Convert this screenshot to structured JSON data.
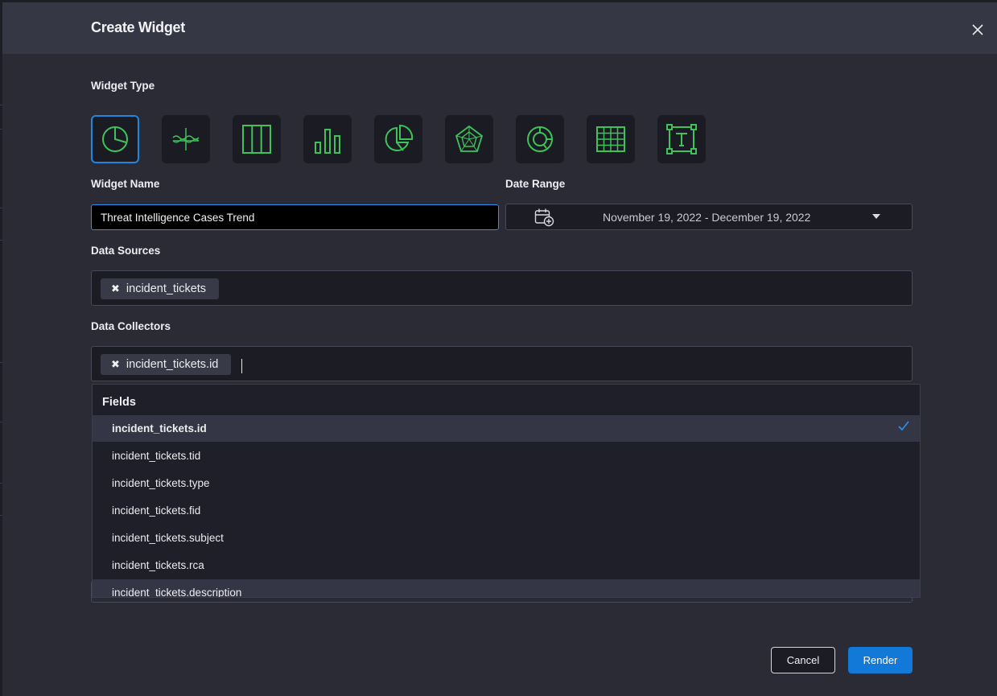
{
  "modal": {
    "title": "Create Widget"
  },
  "widget_type": {
    "label": "Widget Type",
    "types": [
      {
        "icon": "pie-chart-icon",
        "selected": true
      },
      {
        "icon": "line-wave-icon",
        "selected": false
      },
      {
        "icon": "columns-icon",
        "selected": false
      },
      {
        "icon": "bar-chart-icon",
        "selected": false
      },
      {
        "icon": "pie-3d-icon",
        "selected": false
      },
      {
        "icon": "radar-chart-icon",
        "selected": false
      },
      {
        "icon": "donut-chart-icon",
        "selected": false
      },
      {
        "icon": "table-grid-icon",
        "selected": false
      },
      {
        "icon": "text-box-icon",
        "selected": false
      }
    ]
  },
  "widget_name": {
    "label": "Widget Name",
    "value": "Threat Intelligence Cases Trend"
  },
  "date_range": {
    "label": "Date Range",
    "value": "November 19, 2022 - December 19, 2022"
  },
  "data_sources": {
    "label": "Data Sources",
    "tags": [
      "incident_tickets"
    ]
  },
  "data_collectors": {
    "label": "Data Collectors",
    "tags": [
      "incident_tickets.id"
    ]
  },
  "fields_dropdown": {
    "group_title": "Fields",
    "options": [
      {
        "label": "incident_tickets.id",
        "selected": true
      },
      {
        "label": "incident_tickets.tid",
        "selected": false
      },
      {
        "label": "incident_tickets.type",
        "selected": false
      },
      {
        "label": "incident_tickets.fid",
        "selected": false
      },
      {
        "label": "incident_tickets.subject",
        "selected": false
      },
      {
        "label": "incident_tickets.rca",
        "selected": false
      },
      {
        "label": "incident_tickets.description",
        "selected": false
      }
    ]
  },
  "buttons": {
    "cancel": "Cancel",
    "render": "Render"
  },
  "colors": {
    "accent": "#1279d8",
    "icon_green": "#3fc25a",
    "modal_bg": "#2a2b35",
    "header_bg": "#363745"
  }
}
